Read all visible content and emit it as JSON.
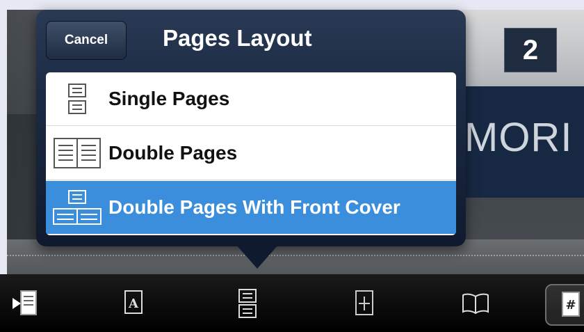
{
  "popover": {
    "cancel_label": "Cancel",
    "title": "Pages Layout",
    "options": [
      {
        "label": "Single Pages",
        "icon": "single-pages-icon",
        "selected": false
      },
      {
        "label": "Double Pages",
        "icon": "double-pages-icon",
        "selected": false
      },
      {
        "label": "Double Pages With Front Cover",
        "icon": "double-pages-front-cover-icon",
        "selected": true
      }
    ]
  },
  "background": {
    "badge": "2",
    "partial_text": "MORI"
  },
  "toolbar": {
    "buttons": [
      {
        "icon": "import-icon"
      },
      {
        "icon": "text-page-icon"
      },
      {
        "icon": "page-layout-icon"
      },
      {
        "icon": "crop-icon"
      },
      {
        "icon": "book-icon"
      },
      {
        "icon": "page-number-icon"
      }
    ]
  },
  "colors": {
    "selection": "#3b8edb",
    "popover": "#1c2b44",
    "toolbar": "#000000"
  }
}
